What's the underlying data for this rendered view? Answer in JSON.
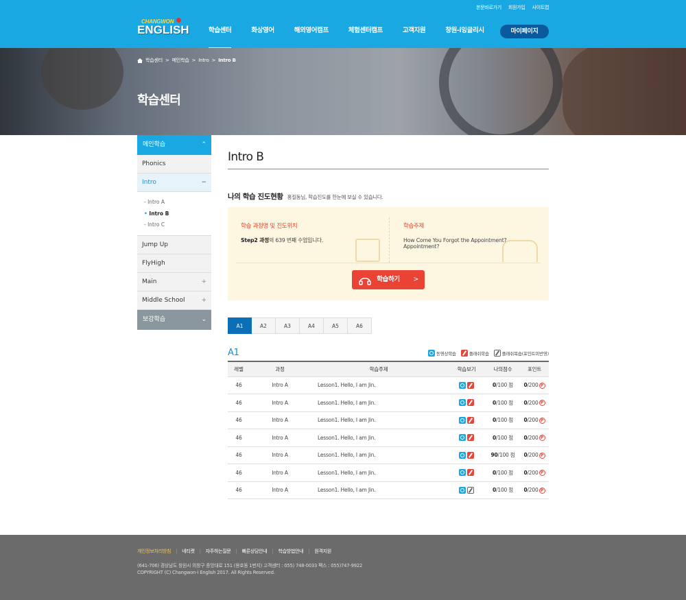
{
  "util": [
    "본문바로가기",
    "회원가입",
    "사이트맵"
  ],
  "logo": {
    "line1": "CHANGWON",
    "line2": "ENGLISH"
  },
  "gnb": [
    "학습센터",
    "화상영어",
    "해외영어캠프",
    "체험센터캠프",
    "고객지원",
    "창원-i잉글리시"
  ],
  "mypage_label": "마이페이지",
  "breadcrumb": [
    "학습센터",
    "메인학습",
    "Intro",
    "Intro B"
  ],
  "visual_title": "학습센터",
  "lnb": {
    "top": "메인학습",
    "phonics": "Phonics",
    "intro": "Intro",
    "intro_subs": [
      "Intro A",
      "Intro B",
      "Intro C"
    ],
    "jumpup": "Jump Up",
    "flyhigh": "FlyHigh",
    "main": "Main",
    "middle": "Middle School",
    "bottom": "보강학습"
  },
  "page_title": "Intro B",
  "section": {
    "title": "나의 학습 진도현황",
    "desc": "홍길동님, 학습진도를 한눈에 보실 수 있습니다."
  },
  "progress": {
    "label1": "학습 과정명 및 진도위치",
    "course": "Step2 과정",
    "value1": "의 639 번째 수업입니다.",
    "label2": "학습주제",
    "topic1": "How Come You Forgot the Appointment?",
    "topic2": "Appointment?",
    "button": "학습하기"
  },
  "tabs": [
    "A1",
    "A2",
    "A3",
    "A4",
    "A5",
    "A6"
  ],
  "table_level": "A1",
  "legend": [
    "동영상학습",
    "플래쉬학습",
    "플래쉬복습(포인트미반영)"
  ],
  "table": {
    "headers": [
      "레벨",
      "과정",
      "학습주제",
      "학습보기",
      "나의점수",
      "포인트"
    ],
    "rows": [
      {
        "level": "46",
        "course": "Intro A",
        "subject": "Lesson1. Hello, I am Jin.",
        "score": "0",
        "score_suffix": "/100 점",
        "point": "0",
        "point_suffix": "/200",
        "icon2": "f"
      },
      {
        "level": "46",
        "course": "Intro A",
        "subject": "Lesson1. Hello, I am Jin.",
        "score": "0",
        "score_suffix": "/100 점",
        "point": "0",
        "point_suffix": "/200",
        "icon2": "f"
      },
      {
        "level": "46",
        "course": "Intro A",
        "subject": "Lesson1. Hello, I am Jin.",
        "score": "0",
        "score_suffix": "/100 점",
        "point": "0",
        "point_suffix": "/200",
        "icon2": "f"
      },
      {
        "level": "46",
        "course": "Intro A",
        "subject": "Lesson1. Hello, I am Jin.",
        "score": "0",
        "score_suffix": "/100 점",
        "point": "0",
        "point_suffix": "/200",
        "icon2": "f"
      },
      {
        "level": "46",
        "course": "Intro A",
        "subject": "Lesson1. Hello, I am Jin.",
        "score": "90",
        "score_suffix": "/100 점",
        "point": "0",
        "point_suffix": "/200",
        "icon2": "f"
      },
      {
        "level": "46",
        "course": "Intro A",
        "subject": "Lesson1. Hello, I am Jin.",
        "score": "0",
        "score_suffix": "/100 점",
        "point": "0",
        "point_suffix": "/200",
        "icon2": "f"
      },
      {
        "level": "46",
        "course": "Intro A",
        "subject": "Lesson1. Hello, I am Jin.",
        "score": "0",
        "score_suffix": "/100 점",
        "point": "0",
        "point_suffix": "/200",
        "icon2": "r"
      }
    ]
  },
  "point_mark": "P",
  "footer": {
    "links": [
      "개인정보처리방침",
      "네티켓",
      "자주하는질문",
      "빠른상담안내",
      "학습방법안내",
      "원격지원"
    ],
    "address": "(641-706) 경상남도 창원시 의창구 중앙대로 151 (용호동 1번지)    고객센터 : 055) 748-0033    팩스 : 055)747-9922",
    "copyright": "COPYRIGHT (C) Changwon-i English 2017. All Rights Reserved."
  },
  "colors": {
    "brand": "#1aa8e2",
    "accent": "#ea4335",
    "tab_active": "#0b6fb8",
    "footer": "#6b6b6b"
  }
}
